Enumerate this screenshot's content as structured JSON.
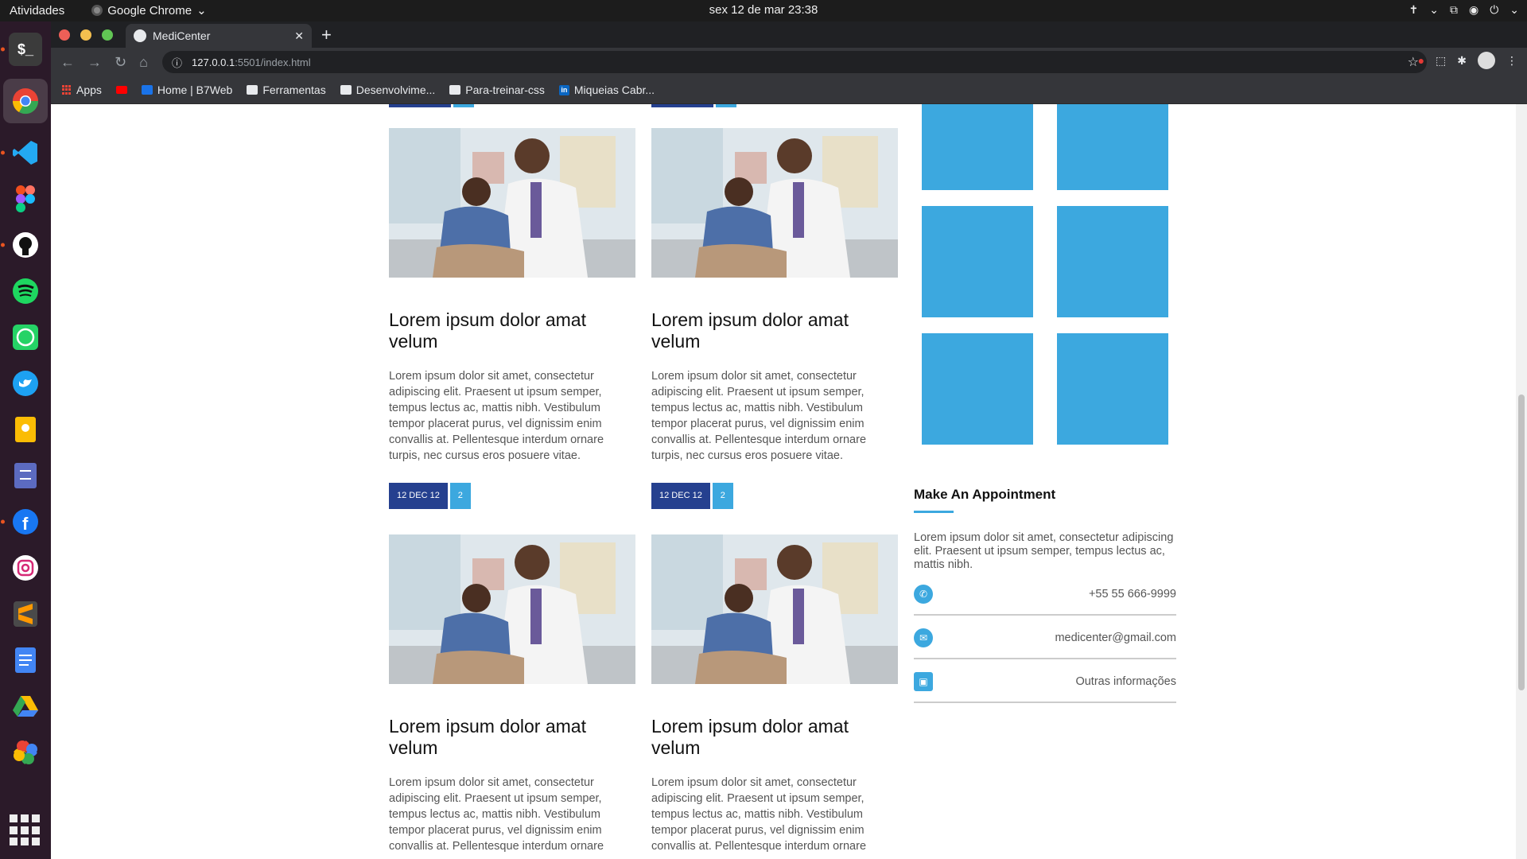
{
  "os": {
    "activities": "Atividades",
    "app_menu": "Google Chrome",
    "clock": "sex 12 de mar  23:38"
  },
  "browser": {
    "tab_title": "MediCenter",
    "url_host": "127.0.0.1",
    "url_rest": ":5501/index.html",
    "bookmarks": [
      "Apps",
      "Home | B7Web",
      "Ferramentas",
      "Desenvolvime...",
      "Para-treinar-css",
      "Miqueias Cabr..."
    ]
  },
  "posts": [
    {
      "title": "Lorem ipsum dolor amat velum",
      "text": "Lorem ipsum dolor sit amet, consectetur adipiscing elit. Praesent ut ipsum semper, tempus lectus ac, mattis nibh. Vestibulum tempor placerat purus, vel dignissim enim convallis at. Pellentesque interdum ornare turpis, nec cursus eros posuere vitae.",
      "date": "12 DEC 12",
      "comments": "2"
    },
    {
      "title": "Lorem ipsum dolor amat velum",
      "text": "Lorem ipsum dolor sit amet, consectetur adipiscing elit. Praesent ut ipsum semper, tempus lectus ac, mattis nibh. Vestibulum tempor placerat purus, vel dignissim enim convallis at. Pellentesque interdum ornare turpis, nec cursus eros posuere vitae.",
      "date": "12 DEC 12",
      "comments": "2"
    },
    {
      "title": "Lorem ipsum dolor amat velum",
      "text": "Lorem ipsum dolor sit amet, consectetur adipiscing elit. Praesent ut ipsum semper, tempus lectus ac, mattis nibh. Vestibulum tempor placerat purus, vel dignissim enim convallis at. Pellentesque interdum ornare"
    },
    {
      "title": "Lorem ipsum dolor amat velum",
      "text": "Lorem ipsum dolor sit amet, consectetur adipiscing elit. Praesent ut ipsum semper, tempus lectus ac, mattis nibh. Vestibulum tempor placerat purus, vel dignissim enim convallis at. Pellentesque interdum ornare"
    }
  ],
  "sidebar": {
    "appointment": {
      "title": "Make An Appointment",
      "text": "Lorem ipsum dolor sit amet, consectetur adipiscing elit. Praesent ut ipsum semper, tempus lectus ac, mattis nibh.",
      "phone": "+55 55 666-9999",
      "email": "medicenter@gmail.com",
      "other": "Outras informações"
    }
  },
  "colors": {
    "accent_blue": "#3ca8df",
    "dark_blue": "#25408f"
  }
}
